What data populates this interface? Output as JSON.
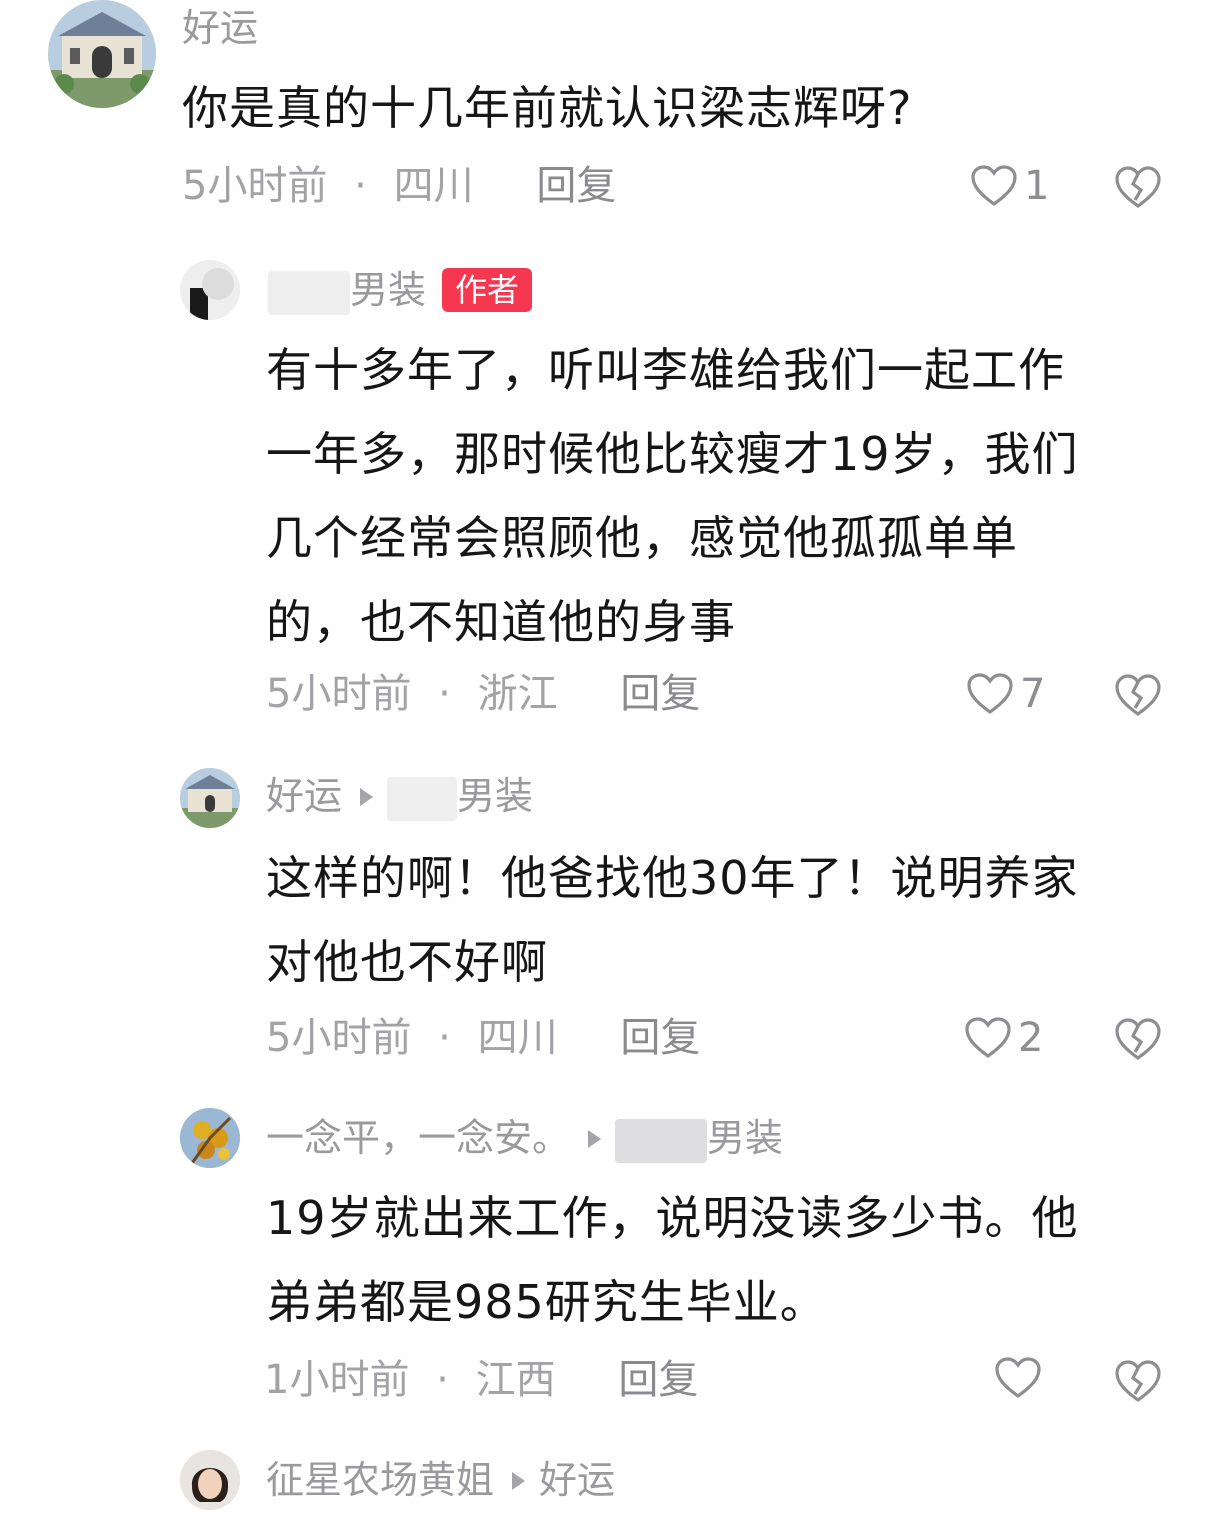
{
  "comments": [
    {
      "name": "好运",
      "text": "你是真的十几年前就认识梁志辉呀?",
      "time": "5小时前",
      "region": "四川",
      "reply": "回复",
      "likes": "1",
      "avatar_icon": "mansion-avatar"
    },
    {
      "name_visible": "男装",
      "badge": "作者",
      "text_lines": [
        "有十多年了，听叫李雄给我们一起工作",
        "一年多，那时候他比较瘦才19岁，我们",
        "几个经常会照顾他，感觉他孤孤单单",
        "的，也不知道他的身事"
      ],
      "time": "5小时前",
      "region": "浙江",
      "reply": "回复",
      "likes": "7"
    },
    {
      "name": "好运",
      "reply_to_visible": "男装",
      "text_lines": [
        "这样的啊！他爸找他30年了！说明养家",
        "对他也不好啊"
      ],
      "time": "5小时前",
      "region": "四川",
      "reply": "回复",
      "likes": "2"
    },
    {
      "name": "一念平，一念安。",
      "reply_to_visible": "男装",
      "text_lines": [
        "19岁就出来工作，说明没读多少书。他",
        "弟弟都是985研究生毕业。"
      ],
      "time": "1小时前",
      "region": "江西",
      "reply": "回复",
      "likes": ""
    },
    {
      "name": "征星农场黄姐",
      "reply_to": "好运"
    }
  ],
  "separator": "·",
  "colors": {
    "text": "#161616",
    "muted": "#a3a3a7",
    "badge": "#f5384f"
  }
}
